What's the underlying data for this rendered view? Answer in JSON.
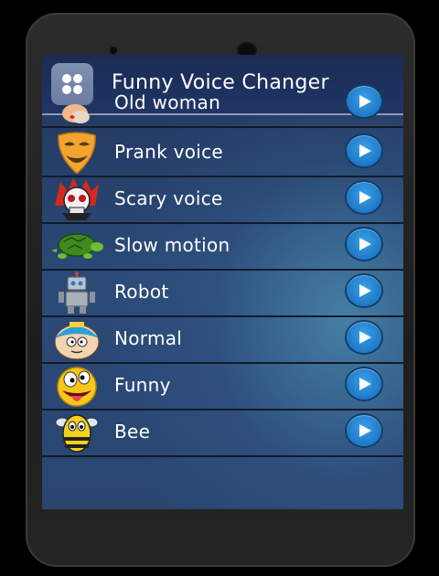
{
  "app": {
    "title": "Funny Voice Changer",
    "icon_name": "grid-apps-icon"
  },
  "effects": [
    {
      "label": "Old woman",
      "icon": "old-woman-icon"
    },
    {
      "label": "Prank voice",
      "icon": "mask-icon"
    },
    {
      "label": "Scary voice",
      "icon": "skull-icon"
    },
    {
      "label": "Slow motion",
      "icon": "turtle-icon"
    },
    {
      "label": "Robot",
      "icon": "robot-icon"
    },
    {
      "label": "Normal",
      "icon": "cartoon-boy-icon"
    },
    {
      "label": "Funny",
      "icon": "crazy-smiley-icon"
    },
    {
      "label": "Bee",
      "icon": "bee-icon"
    }
  ],
  "colors": {
    "play_button": "#1f78c7",
    "header": "#1a2c55",
    "list_background": "#2b4a78"
  }
}
